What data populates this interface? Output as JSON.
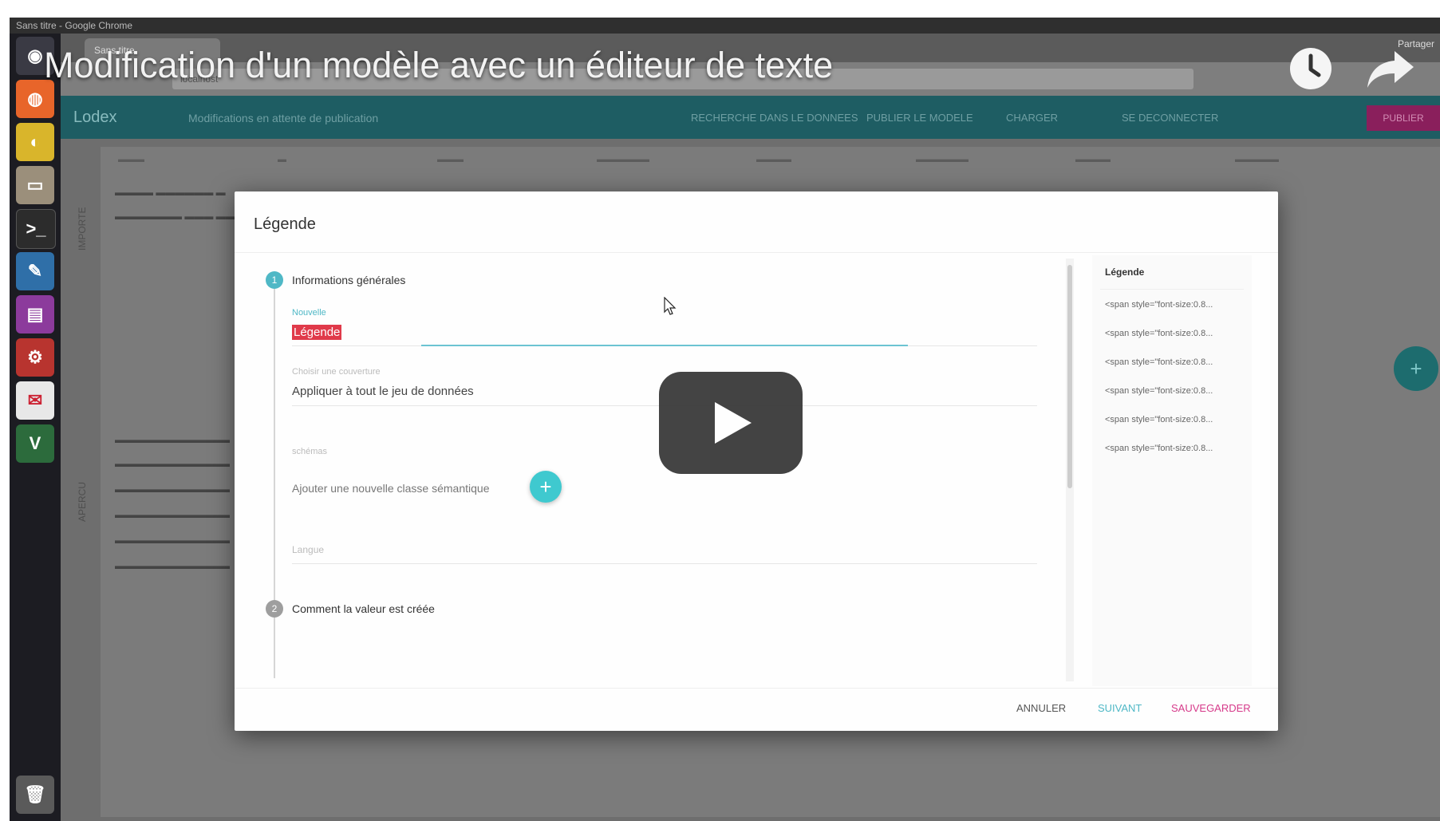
{
  "video": {
    "title": "Modification d'un modèle avec un éditeur de texte",
    "share_label": "Partager"
  },
  "os": {
    "topbar_text": "Sans titre - Google Chrome",
    "launcher_icons": [
      "ubuntu-logo-icon",
      "firefox-icon",
      "chrome-icon",
      "files-icon",
      "terminal-icon",
      "editor-icon",
      "calendar-icon",
      "settings-icon",
      "notes-icon",
      "vim-icon",
      "trash-icon"
    ]
  },
  "browser": {
    "tab_title": "Sans titre",
    "address": "localhost"
  },
  "app": {
    "brand": "Lodex",
    "tagline": "Modifications en attente de publication",
    "nav": [
      "RECHERCHE DANS LE DONNEES",
      "PUBLIER LE MODELE",
      "CHARGER",
      "SE DECONNECTER"
    ],
    "publish_button": "PUBLIER",
    "bg_section_top": "IMPORTE",
    "bg_section_bottom": "APERCU"
  },
  "modal": {
    "title": "Légende",
    "step1_number": "1",
    "step1_label": "Informations générales",
    "field_label_label": "Nouvelle",
    "field_label_value": "Légende",
    "field_cover_label": "Choisir une couverture",
    "field_cover_value": "Appliquer à tout le jeu de données",
    "field_scheme_label": "schémas",
    "add_scheme_label": "Ajouter une nouvelle classe sémantique",
    "field_lang_label": "Langue",
    "step2_number": "2",
    "step2_label": "Comment la valeur est créée",
    "legend_title": "Légende",
    "legend_items": [
      "<span style=\"font-size:0.8...",
      "<span style=\"font-size:0.8...",
      "<span style=\"font-size:0.8...",
      "<span style=\"font-size:0.8...",
      "<span style=\"font-size:0.8...",
      "<span style=\"font-size:0.8..."
    ],
    "cancel_label": "ANNULER",
    "next_label": "SUIVANT",
    "save_label": "SAUVEGARDER"
  },
  "colors": {
    "header": "#1e5d63",
    "accent": "#3fc9cf",
    "save": "#d63a8a",
    "selection": "#e03a4a"
  }
}
